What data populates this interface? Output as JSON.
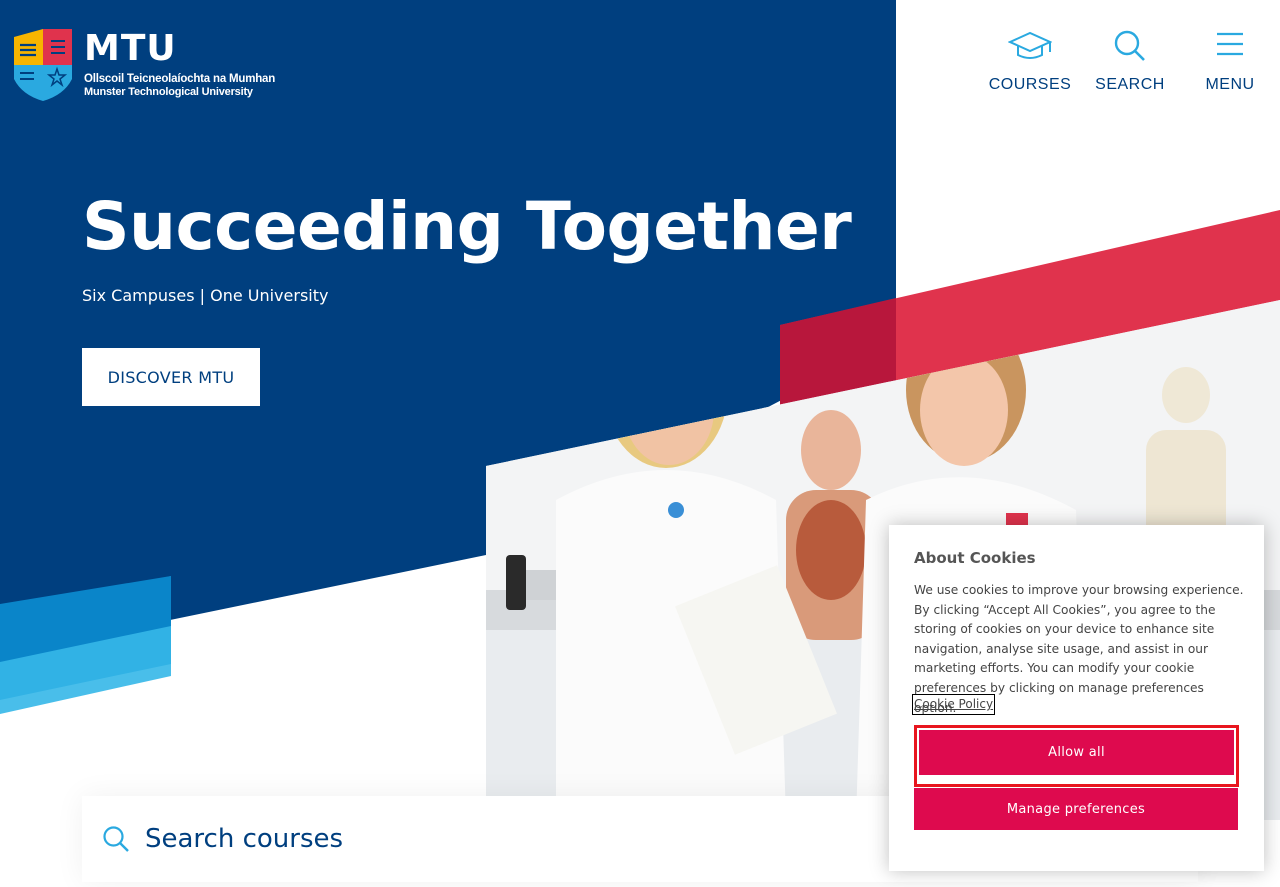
{
  "brand": {
    "short_name": "MTU",
    "irish_name": "Ollscoil Teicneolaíochta na Mumhan",
    "english_name": "Munster Technological University"
  },
  "nav": {
    "courses_label": "COURSES",
    "search_label": "SEARCH",
    "menu_label": "MENU"
  },
  "hero": {
    "title": "Succeeding Together",
    "subtitle": "Six Campuses | One University",
    "cta_label": "DISCOVER MTU"
  },
  "search": {
    "placeholder": "Search courses"
  },
  "cookie_banner": {
    "title": "About Cookies",
    "body": "We use cookies to improve your browsing experience. By clicking “Accept All Cookies”, you agree to the storing of cookies on your device to enhance site navigation, analyse site usage, and assist in our marketing efforts. You can modify your cookie preferences by clicking on manage preferences option.",
    "policy_link": "Cookie Policy",
    "allow_all_label": "Allow all",
    "manage_label": "Manage preferences"
  },
  "colors": {
    "primary_blue": "#003f7f",
    "accent_red": "#e0334d",
    "accent_cyan": "#2aa9e0",
    "cookie_button": "#de0a4e"
  }
}
